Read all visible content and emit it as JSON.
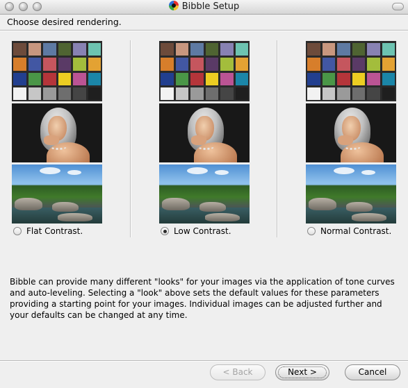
{
  "window": {
    "title": "Bibble Setup"
  },
  "heading": "Choose desired rendering.",
  "options": [
    {
      "label": "Flat Contrast.",
      "checked": false
    },
    {
      "label": "Low Contrast.",
      "checked": true
    },
    {
      "label": "Normal Contrast.",
      "checked": false
    }
  ],
  "checker_colors": [
    "#6d4b3b",
    "#c8977f",
    "#5e7aa3",
    "#4f6432",
    "#8882b3",
    "#6dc3b1",
    "#d77e2b",
    "#4257a3",
    "#c5565e",
    "#5a3a66",
    "#a3bd3c",
    "#e3a233",
    "#223f8f",
    "#4a9647",
    "#b5353a",
    "#eccd22",
    "#bb5494",
    "#1b86a8",
    "#f2f2f2",
    "#c6c6c6",
    "#9a9a9a",
    "#6e6e6e",
    "#454545",
    "#1f1f1f"
  ],
  "description": "Bibble can provide many different \"looks\" for your images via the application of tone curves and auto-leveling.  Selecting a \"look\" above sets the default values for these parameters providing a starting point for your images.  Individual images can be adjusted further and your defaults can be changed at any time.",
  "buttons": {
    "back": "< Back",
    "next": "Next >",
    "cancel": "Cancel"
  }
}
